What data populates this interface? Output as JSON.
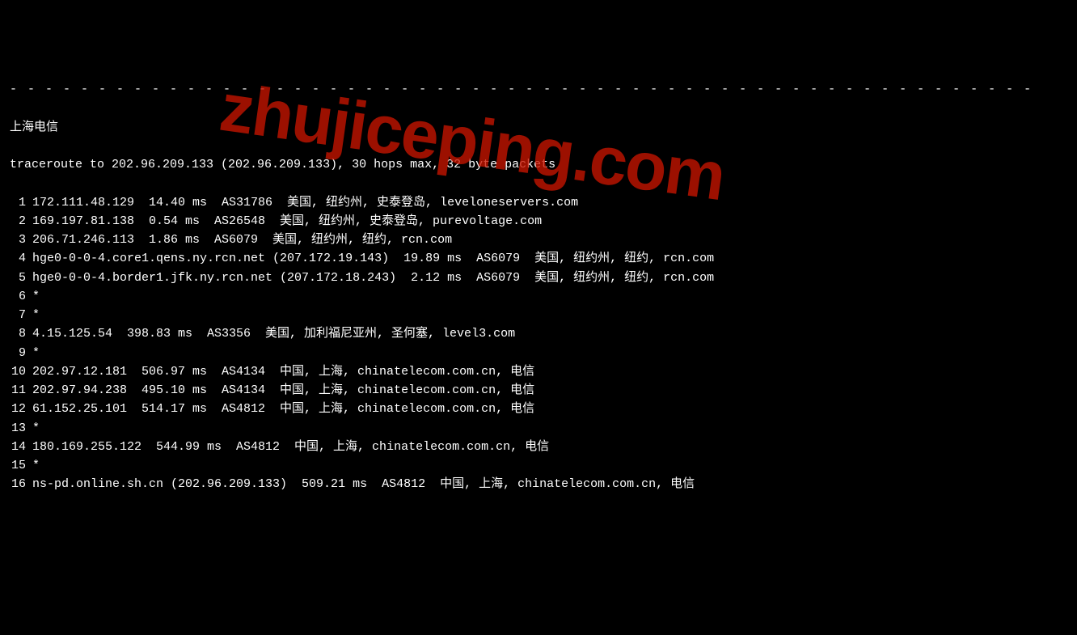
{
  "dash_line": "- - - - - - - - - - - - - - - - - - - - - - - - - - - - - - - - - - - - - - - - - - - - - - - - - - - - - - - - - -",
  "title": "上海电信",
  "intro": "traceroute to 202.96.209.133 (202.96.209.133), 30 hops max, 32 byte packets",
  "watermark": "zhujiceping.com",
  "hops": [
    {
      "n": "1",
      "line": "172.111.48.129  14.40 ms  AS31786  美国, 纽约州, 史泰登岛, leveloneservers.com"
    },
    {
      "n": "2",
      "line": "169.197.81.138  0.54 ms  AS26548  美国, 纽约州, 史泰登岛, purevoltage.com"
    },
    {
      "n": "3",
      "line": "206.71.246.113  1.86 ms  AS6079  美国, 纽约州, 纽约, rcn.com"
    },
    {
      "n": "4",
      "line": "hge0-0-0-4.core1.qens.ny.rcn.net (207.172.19.143)  19.89 ms  AS6079  美国, 纽约州, 纽约, rcn.com"
    },
    {
      "n": "5",
      "line": "hge0-0-0-4.border1.jfk.ny.rcn.net (207.172.18.243)  2.12 ms  AS6079  美国, 纽约州, 纽约, rcn.com"
    },
    {
      "n": "6",
      "line": "*"
    },
    {
      "n": "7",
      "line": "*"
    },
    {
      "n": "8",
      "line": "4.15.125.54  398.83 ms  AS3356  美国, 加利福尼亚州, 圣何塞, level3.com"
    },
    {
      "n": "9",
      "line": "*"
    },
    {
      "n": "10",
      "line": "202.97.12.181  506.97 ms  AS4134  中国, 上海, chinatelecom.com.cn, 电信"
    },
    {
      "n": "11",
      "line": "202.97.94.238  495.10 ms  AS4134  中国, 上海, chinatelecom.com.cn, 电信"
    },
    {
      "n": "12",
      "line": "61.152.25.101  514.17 ms  AS4812  中国, 上海, chinatelecom.com.cn, 电信"
    },
    {
      "n": "13",
      "line": "*"
    },
    {
      "n": "14",
      "line": "180.169.255.122  544.99 ms  AS4812  中国, 上海, chinatelecom.com.cn, 电信"
    },
    {
      "n": "15",
      "line": "*"
    },
    {
      "n": "16",
      "line": "ns-pd.online.sh.cn (202.96.209.133)  509.21 ms  AS4812  中国, 上海, chinatelecom.com.cn, 电信"
    }
  ]
}
